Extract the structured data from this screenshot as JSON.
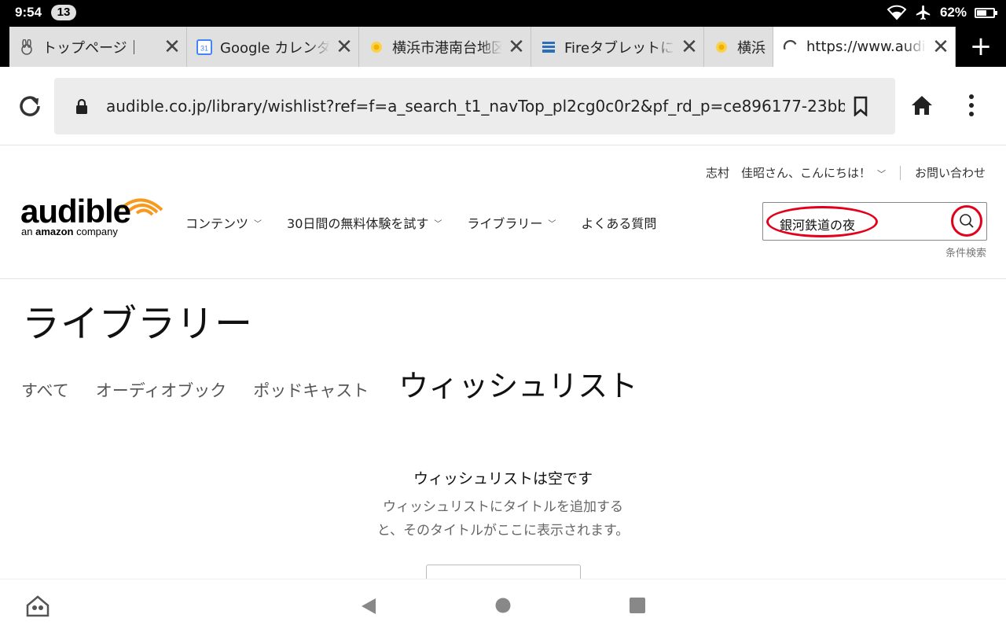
{
  "status_bar": {
    "time": "9:54",
    "notification_count": "13",
    "battery": "62%",
    "battery_level": 0.62
  },
  "tabs": [
    {
      "title": "トップページ｜",
      "favicon": "rabbit-icon",
      "active": false
    },
    {
      "title": "Google カレンダー",
      "favicon": "google-calendar-icon",
      "favicon_text": "31",
      "active": false
    },
    {
      "title": "横浜市港南台地区",
      "favicon": "sun-icon",
      "active": false
    },
    {
      "title": "Fireタブレットに",
      "favicon": "site-icon",
      "active": false
    },
    {
      "title": "横浜",
      "favicon": "sun-icon",
      "active": false
    },
    {
      "title": "https://www.audible",
      "favicon": "loading-spinner-icon",
      "active": true
    }
  ],
  "toolbar": {
    "url": "audible.co.jp/library/wishlist?ref=f=a_search_t1_navTop_pl2cg0c0r2&pf_rd_p=ce896177-23bb-470c-a"
  },
  "header": {
    "greeting": "志村　佳昭さん、こんにちは！",
    "contact": "お問い合わせ",
    "logo_word": "audible",
    "logo_sub_prefix": "an",
    "logo_sub_brand": "amazon",
    "logo_sub_suffix": "company",
    "nav": [
      {
        "label": "コンテンツ",
        "dropdown": true
      },
      {
        "label": "30日間の無料体験を試す",
        "dropdown": true
      },
      {
        "label": "ライブラリー",
        "dropdown": true
      },
      {
        "label": "よくある質問",
        "dropdown": false
      }
    ],
    "search_value": "銀河鉄道の夜",
    "advanced_search": "条件検索"
  },
  "main": {
    "page_title": "ライブラリー",
    "library_tabs": [
      {
        "label": "すべて",
        "active": false
      },
      {
        "label": "オーディオブック",
        "active": false
      },
      {
        "label": "ポッドキャスト",
        "active": false
      },
      {
        "label": "ウィッシュリスト",
        "active": true
      }
    ],
    "empty_title": "ウィッシュリストは空です",
    "empty_desc_line1": "ウィッシュリストにタイトルを追加する",
    "empty_desc_line2": "と、そのタイトルがここに表示されます。"
  },
  "colors": {
    "accent_orange": "#f7991c",
    "annotation_red": "#e3001b",
    "calendar_blue": "#4285f4"
  }
}
